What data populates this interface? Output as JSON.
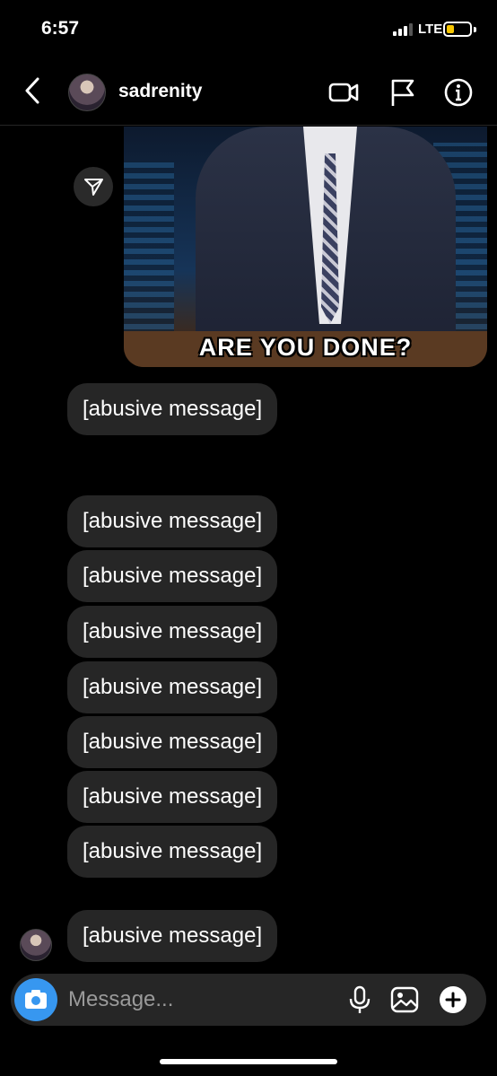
{
  "status_bar": {
    "time": "6:57",
    "network": "LTE",
    "battery_level": 0.3
  },
  "header": {
    "username": "sadrenity",
    "icons": [
      "back-chevron-icon",
      "video-call-icon",
      "flag-icon",
      "info-icon"
    ]
  },
  "gif": {
    "caption": "ARE YOU DONE?"
  },
  "messages": [
    {
      "text": "[abusive message]"
    },
    {
      "text": "[abusive message]"
    },
    {
      "text": "[abusive message]"
    },
    {
      "text": "[abusive message]"
    },
    {
      "text": "[abusive message]"
    },
    {
      "text": "[abusive message]"
    },
    {
      "text": "[abusive message]"
    },
    {
      "text": "[abusive message]"
    },
    {
      "text": "[abusive message]"
    }
  ],
  "composer": {
    "placeholder": "Message...",
    "icons": [
      "camera-icon",
      "microphone-icon",
      "gallery-icon",
      "plus-icon"
    ]
  },
  "colors": {
    "accent": "#3797f0",
    "bubble": "#262626",
    "background": "#000000",
    "battery": "#f7c600"
  }
}
